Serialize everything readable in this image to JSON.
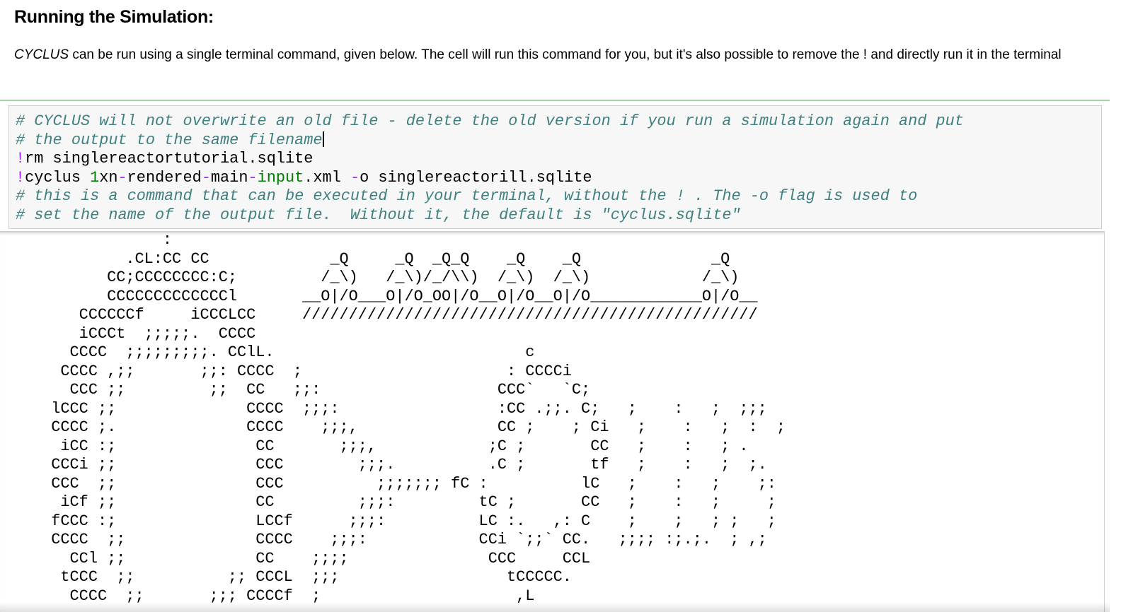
{
  "markdown": {
    "heading": "Running the Simulation:",
    "paragraph_em": "CYCLUS",
    "paragraph_rest": " can be run using a single terminal command, given below. The cell will run this command for you, but it's also possible to remove the ! and directly run it in the terminal"
  },
  "code": {
    "line1": "# CYCLUS will not overwrite an old file - delete the old version if you run a simulation again and put",
    "line2": "# the output to the same filename",
    "line3_bang": "!",
    "line3_rest": "rm singlereactortutorial.sqlite",
    "line4_bang": "!",
    "line4_cmd": "cyclus ",
    "line4_num": "1",
    "line4_a": "xn",
    "line4_op1": "-",
    "line4_b": "rendered",
    "line4_op2": "-",
    "line4_c": "main",
    "line4_op3": "-",
    "line4_builtin": "input",
    "line4_d": ".xml ",
    "line4_op4": "-",
    "line4_e": "o singlereactorill.sqlite",
    "line5": "# this is a command that can be executed in your terminal, without the ! . The -o flag is used to",
    "line6": "# set the name of the output file.  Without it, the default is \"cyclus.sqlite\""
  },
  "output": {
    "ascii_lines": [
      "              :",
      "          .CL:CC CC             _Q     _Q  _Q_Q    _Q    _Q              _Q",
      "        CC;CCCCCCCC:C;         /_\\)   /_\\)/_/\\\\)  /_\\)  /_\\)            /_\\)",
      "        CCCCCCCCCCCCCl       __O|/O___O|/O_OO|/O__O|/O__O|/O____________O|/O__",
      "     CCCCCCf     iCCCLCC     /////////////////////////////////////////////////",
      "     iCCCt  ;;;;;.  CCCC",
      "    CCCC  ;;;;;;;;;. CClL.                           c",
      "   CCCC ,;;       ;;: CCCC  ;                      : CCCCi",
      "    CCC ;;         ;;  CC   ;;:                   CCC`   `C;",
      "  lCCC ;;              CCCC  ;;;:                 :CC .;;. C;   ;    :   ;  ;;;",
      "  CCCC ;.              CCCC    ;;;,               CC ;    ; Ci   ;    :   ;  :  ;",
      "   iCC :;               CC       ;;;,            ;C ;       CC   ;    :   ; .",
      "  CCCi ;;               CCC        ;;;.          .C ;       tf   ;    :   ;  ;.",
      "  CCC  ;;               CCC          ;;;;;;; fC :          lC   ;    :   ;    ;:",
      "   iCf ;;               CC         ;;;:         tC ;       CC   ;    :   ;     ;",
      "  fCCC :;               LCCf      ;;;:          LC :.   ,: C    ;    ;   ; ;   ;",
      "  CCCC  ;;              CCCC    ;;;:            CCi `;;` CC.   ;;;; :;.;.  ; ,;",
      "    CCl ;;              CC    ;;;;               CCC     CCL",
      "   tCCC  ;;          ;; CCCL  ;;;                  tCCCCC.",
      "    CCCC  ;;       ;;; CCCCf  ;                     ,L"
    ]
  }
}
